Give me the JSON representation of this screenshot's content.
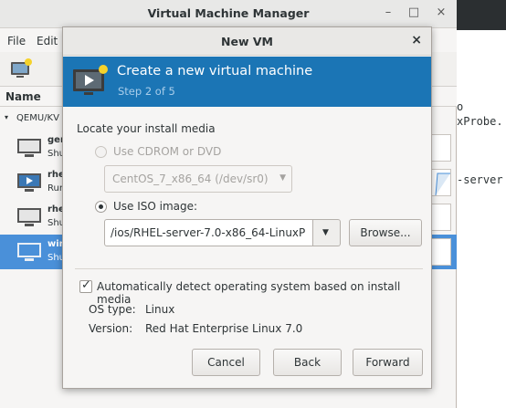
{
  "background_terminal": {
    "line1": "o",
    "line2": "xProbe.",
    "line3": "-server"
  },
  "main_window": {
    "title": "Virtual Machine Manager",
    "controls": {
      "minimize": "–",
      "maximize": "□",
      "close": "×"
    },
    "menu": {
      "file": "File",
      "edit": "Edit"
    },
    "list_header": "Name",
    "group": "QEMU/KV",
    "vms": [
      {
        "name": "ger",
        "state": "Shu"
      },
      {
        "name": "rhe",
        "state": "Run"
      },
      {
        "name": "rhe",
        "state": "Shu"
      },
      {
        "name": "win",
        "state": "Shu"
      }
    ]
  },
  "dialog": {
    "title": "New VM",
    "close": "×",
    "banner": {
      "title": "Create a new virtual machine",
      "step": "Step 2 of 5"
    },
    "section_label": "Locate your install media",
    "cdrom": {
      "label": "Use CDROM or DVD",
      "device": "CentOS_7_x86_64 (/dev/sr0)",
      "enabled": false
    },
    "iso": {
      "label": "Use ISO image:",
      "path": "/ios/RHEL-server-7.0-x86_64-LinuxP",
      "browse_label": "Browse..."
    },
    "auto_detect": {
      "label": "Automatically detect operating system based on install media",
      "checked": true
    },
    "os_type": {
      "key": "OS type:",
      "value": "Linux"
    },
    "os_version": {
      "key": "Version:",
      "value": "Red Hat Enterprise Linux 7.0"
    },
    "buttons": {
      "cancel": "Cancel",
      "back": "Back",
      "forward": "Forward"
    }
  },
  "colors": {
    "banner": "#1b75b5",
    "selection": "#4a90d9"
  }
}
